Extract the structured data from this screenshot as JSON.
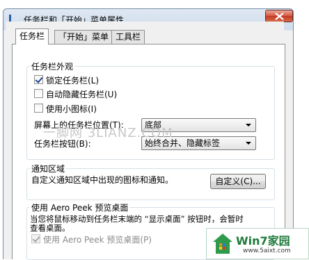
{
  "window": {
    "title": "任务栏和「开始」菜单属性",
    "icon": "taskbar-properties-icon",
    "close_icon": "close-icon"
  },
  "tabs": [
    {
      "label": "任务栏",
      "active": true
    },
    {
      "label": "「开始」菜单",
      "active": false
    },
    {
      "label": "工具栏",
      "active": false
    }
  ],
  "appearance": {
    "title": "任务栏外观",
    "lock_taskbar": {
      "label": "锁定任务栏(L)",
      "checked": true
    },
    "auto_hide": {
      "label": "自动隐藏任务栏(U)",
      "checked": false
    },
    "small_icons": {
      "label": "使用小图标(I)",
      "checked": false
    },
    "location_label": "屏幕上的任务栏位置(T):",
    "location_value": "底部",
    "buttons_label": "任务栏按钮(B):",
    "buttons_value": "始终合并、隐藏标签"
  },
  "notification": {
    "title": "通知区域",
    "description": "自定义通知区域中出现的图标和通知。",
    "customize_button": "自定义(C)..."
  },
  "aero_peek": {
    "title": "使用 Aero Peek 预览桌面",
    "description_line1": "当您将鼠标移动到任务栏末端的 “显示桌面” 按钮时，会暂时",
    "description_line2": "查看桌面。",
    "checkbox": {
      "label": "使用 Aero Peek 预览桌面(P)",
      "checked": true,
      "disabled": true
    }
  },
  "watermark": "一脚网 3LIANZ.COM",
  "logo": {
    "text": "Win7家园",
    "url_text": "www.5aixt.com"
  },
  "colors": {
    "checkmark": "#1c3f8e",
    "close_button": "#c23a22",
    "logo_green": "#1e7a3a"
  }
}
